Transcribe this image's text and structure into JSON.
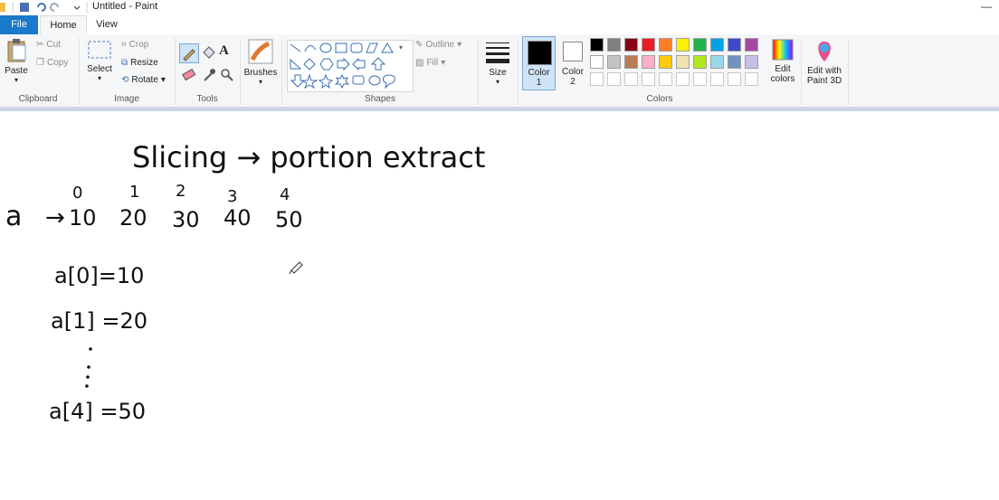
{
  "app": {
    "title": "Untitled - Paint"
  },
  "tabs": [
    {
      "label": "File"
    },
    {
      "label": "Home"
    },
    {
      "label": "View"
    }
  ],
  "ribbon": {
    "clipboard": {
      "paste": "Paste",
      "cut": "Cut",
      "copy": "Copy",
      "group": "Clipboard"
    },
    "image": {
      "select": "Select",
      "crop": "Crop",
      "resize": "Resize",
      "rotate": "Rotate",
      "group": "Image"
    },
    "tools": {
      "group": "Tools"
    },
    "brushes": {
      "label": "Brushes"
    },
    "shapes": {
      "outline": "Outline",
      "fill": "Fill",
      "group": "Shapes"
    },
    "size": {
      "label": "Size"
    },
    "colors": {
      "color1": "Color",
      "color1_num": "1",
      "color2": "Color",
      "color2_num": "2",
      "edit": "Edit",
      "edit2": "colors",
      "group": "Colors",
      "palette_row1": [
        "#000000",
        "#7f7f7f",
        "#880015",
        "#ed1c24",
        "#ff7f27",
        "#fff200",
        "#22b14c",
        "#00a2e8",
        "#3f48cc",
        "#a349a4"
      ],
      "palette_row2": [
        "#ffffff",
        "#c3c3c3",
        "#b97a57",
        "#ffaec9",
        "#ffc90e",
        "#efe4b0",
        "#b5e61d",
        "#99d9ea",
        "#7092be",
        "#c8bfe7"
      ]
    },
    "paint3d": {
      "line1": "Edit with",
      "line2": "Paint 3D"
    }
  },
  "canvas": {
    "heading": "Slicing → portion extract",
    "indices": [
      "0",
      "1",
      "2",
      "3",
      "4"
    ],
    "array_name": "a",
    "arrow": "→",
    "values": [
      "10",
      "20",
      "30",
      "40",
      "50"
    ],
    "lines": [
      "a[0]=10",
      "a[1] =20",
      "a[4] =50"
    ]
  }
}
